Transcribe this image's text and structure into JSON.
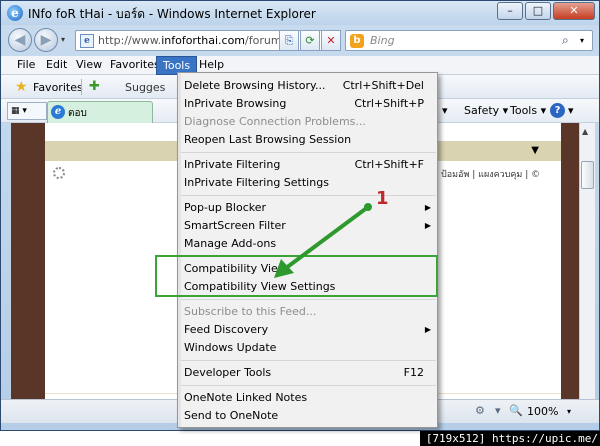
{
  "window": {
    "title": "INfo foR tHai - บอร์ด - Windows Internet Explorer",
    "app_icon_glyph": "e",
    "minimize": "–",
    "maximize": "□",
    "close": "✕"
  },
  "nav": {
    "back": "◀",
    "forward": "▶",
    "dropdown": "▾",
    "url_prefix": "http://www.",
    "url_domain": "infoforthai.com",
    "url_rest": "/forum/i",
    "page_icon": "e",
    "compat_glyph": "⎘",
    "refresh_glyph": "⟳",
    "stop_glyph": "✕",
    "search_placeholder": "Bing",
    "search_icon_glyph": "⌕"
  },
  "menubar": {
    "items": [
      "File",
      "Edit",
      "View",
      "Favorites",
      "Tools",
      "Help"
    ],
    "active": "Tools"
  },
  "favbar": {
    "favorites_label": "Favorites",
    "suggested_label": "Sugges"
  },
  "cmdbar": {
    "tab_title": "ตอบ",
    "tab_icon": "e",
    "safety": "Safety ▾",
    "tools": "Tools ▾",
    "help_glyph": "?"
  },
  "page": {
    "links_text": "ป้อมอัพ | แผงควบคุม | ©"
  },
  "status": {
    "zoom": "100%",
    "zoom_glyph": "🔍"
  },
  "tools_menu": [
    {
      "label": "Delete Browsing History...",
      "shortcut": "Ctrl+Shift+Del"
    },
    {
      "label": "InPrivate Browsing",
      "shortcut": "Ctrl+Shift+P"
    },
    {
      "label": "Diagnose Connection Problems...",
      "disabled": true
    },
    {
      "label": "Reopen Last Browsing Session"
    },
    {
      "label": "InPrivate Filtering",
      "shortcut": "Ctrl+Shift+F"
    },
    {
      "label": "InPrivate Filtering Settings"
    },
    {
      "label": "Pop-up Blocker",
      "submenu": true
    },
    {
      "label": "SmartScreen Filter",
      "submenu": true
    },
    {
      "label": "Manage Add-ons"
    },
    {
      "label": "Compatibility View"
    },
    {
      "label": "Compatibility View Settings"
    },
    {
      "label": "Subscribe to this Feed...",
      "disabled": true
    },
    {
      "label": "Feed Discovery",
      "submenu": true
    },
    {
      "label": "Windows Update"
    },
    {
      "label": "Developer Tools",
      "shortcut": "F12"
    },
    {
      "label": "OneNote Linked Notes"
    },
    {
      "label": "Send to OneNote"
    }
  ],
  "annotation": {
    "number": "1",
    "color": "#2e9a2e",
    "number_color": "#c0282c"
  },
  "credit": "[719x512] https://upic.me/"
}
